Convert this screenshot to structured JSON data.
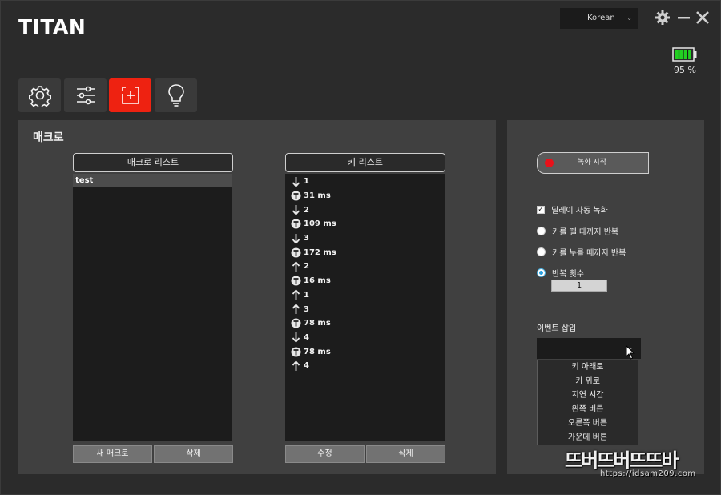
{
  "app": {
    "logo": "TITAN"
  },
  "header": {
    "language": "Korean",
    "battery_percent": 95,
    "battery_text": "95 %"
  },
  "toolbar": {
    "tabs": [
      {
        "icon": "gear-icon"
      },
      {
        "icon": "sliders-icon"
      },
      {
        "icon": "macro-add-icon",
        "active": true
      },
      {
        "icon": "lightbulb-icon"
      }
    ],
    "active_color": "#ee2211"
  },
  "macro_panel": {
    "title": "매크로",
    "macro_list": {
      "header": "매크로 리스트",
      "items": [
        "test"
      ],
      "new_button": "새 매크로",
      "delete_button": "삭제"
    },
    "key_list": {
      "header": "키 리스트",
      "rows": [
        {
          "icon": "arrow-down-icon",
          "text": "1"
        },
        {
          "icon": "timer-icon",
          "text": "31 ms"
        },
        {
          "icon": "arrow-down-icon",
          "text": "2"
        },
        {
          "icon": "timer-icon",
          "text": "109 ms"
        },
        {
          "icon": "arrow-down-icon",
          "text": "3"
        },
        {
          "icon": "timer-icon",
          "text": "172 ms"
        },
        {
          "icon": "arrow-up-icon",
          "text": "2"
        },
        {
          "icon": "timer-icon",
          "text": "16 ms"
        },
        {
          "icon": "arrow-up-icon",
          "text": "1"
        },
        {
          "icon": "arrow-up-icon",
          "text": "3"
        },
        {
          "icon": "timer-icon",
          "text": "78 ms"
        },
        {
          "icon": "arrow-down-icon",
          "text": "4"
        },
        {
          "icon": "timer-icon",
          "text": "78 ms"
        },
        {
          "icon": "arrow-up-icon",
          "text": "4"
        }
      ],
      "edit_button": "수정",
      "delete_button": "삭제"
    }
  },
  "record_panel": {
    "record_button": "녹화 시작",
    "record_color": "#e8111a",
    "delay_record": {
      "label": "딜레이 자동 녹화",
      "checked": true
    },
    "repeat_options": [
      {
        "label": "키를 뗄 때까지 반복",
        "selected": false
      },
      {
        "label": "키를 누를 때까지 반복",
        "selected": false
      },
      {
        "label": "반복 횟수",
        "selected": true
      }
    ],
    "repeat_count": "1",
    "event_insert": {
      "label": "이벤트 삽입",
      "options": [
        "키 아래로",
        "키 위로",
        "지연 시간",
        "왼쪽 버튼",
        "오른쪽 버튼",
        "가운데 버튼"
      ]
    }
  },
  "watermark": {
    "text": "뜨버뜨버뜨뜨바",
    "url": "https://idsam209.com"
  }
}
